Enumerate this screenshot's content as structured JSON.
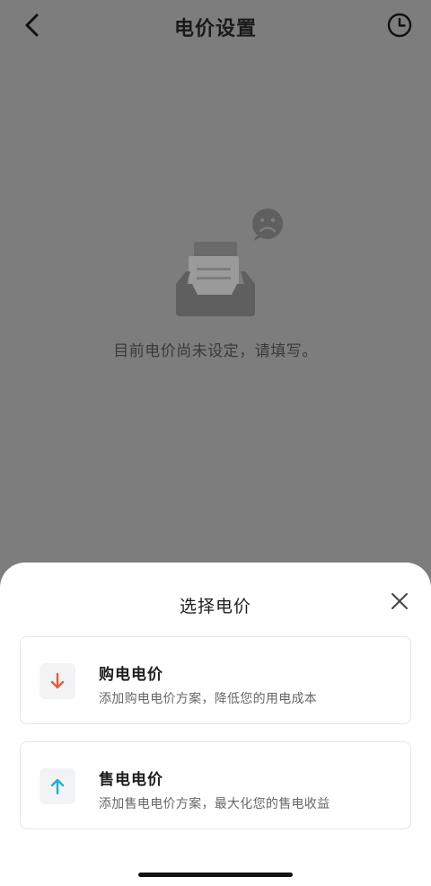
{
  "header": {
    "title": "电价设置",
    "back_icon": "chevron-left-icon",
    "history_icon": "clock-icon"
  },
  "empty_state": {
    "illustration": "empty-inbox-sad-icon",
    "message": "目前电价尚未设定，请填写。"
  },
  "sheet": {
    "title": "选择电价",
    "close_icon": "close-icon",
    "options": [
      {
        "title": "购电电价",
        "description": "添加购电电价方案，降低您的用电成本",
        "icon": "arrow-down-icon",
        "icon_color": "#ee5a3a"
      },
      {
        "title": "售电电价",
        "description": "添加售电电价方案，最大化您的售电收益",
        "icon": "arrow-up-icon",
        "icon_color": "#1fb0cf"
      }
    ]
  },
  "colors": {
    "overlay_bg": "#7d7d7d",
    "sheet_bg": "#ffffff"
  }
}
